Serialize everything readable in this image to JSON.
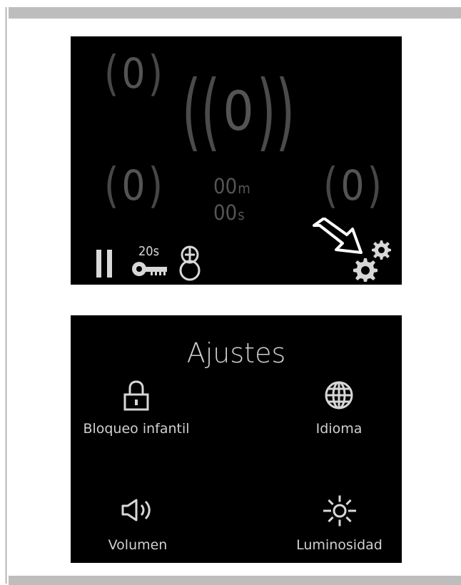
{
  "manual_page": {
    "top_screen": {
      "zones": {
        "top_left": {
          "left": "(",
          "value": "0",
          "right": ")"
        },
        "center": {
          "left": "((",
          "value": "0",
          "right": "))"
        },
        "bottom_left": {
          "left": "(",
          "value": "0",
          "right": ")"
        },
        "bottom_right": {
          "left": "(",
          "value": "0",
          "right": ")"
        }
      },
      "timer": {
        "minutes": "00",
        "minutes_unit": "m",
        "seconds": "00",
        "seconds_unit": "s"
      },
      "status_icons": {
        "pause": "pause-icon",
        "key_timer_label": "20s",
        "key": "key-icon",
        "network": "link-icon",
        "pointer": "arrow-icon",
        "settings": "gear-icon"
      }
    },
    "settings_screen": {
      "title": "Ajustes",
      "items": [
        {
          "label": "Bloqueo infantil",
          "icon": "lock-icon"
        },
        {
          "label": "Idioma",
          "icon": "globe-icon"
        },
        {
          "label": "Volumen",
          "icon": "volume-icon"
        },
        {
          "label": "Luminosidad",
          "icon": "brightness-icon"
        }
      ]
    },
    "colors": {
      "page_background": "#ffffff",
      "screen_background": "#000000",
      "dim_zone_text": "#4a4a4a",
      "bright_text": "#d0d0d0",
      "rule_gray": "#bdbdbd"
    }
  }
}
